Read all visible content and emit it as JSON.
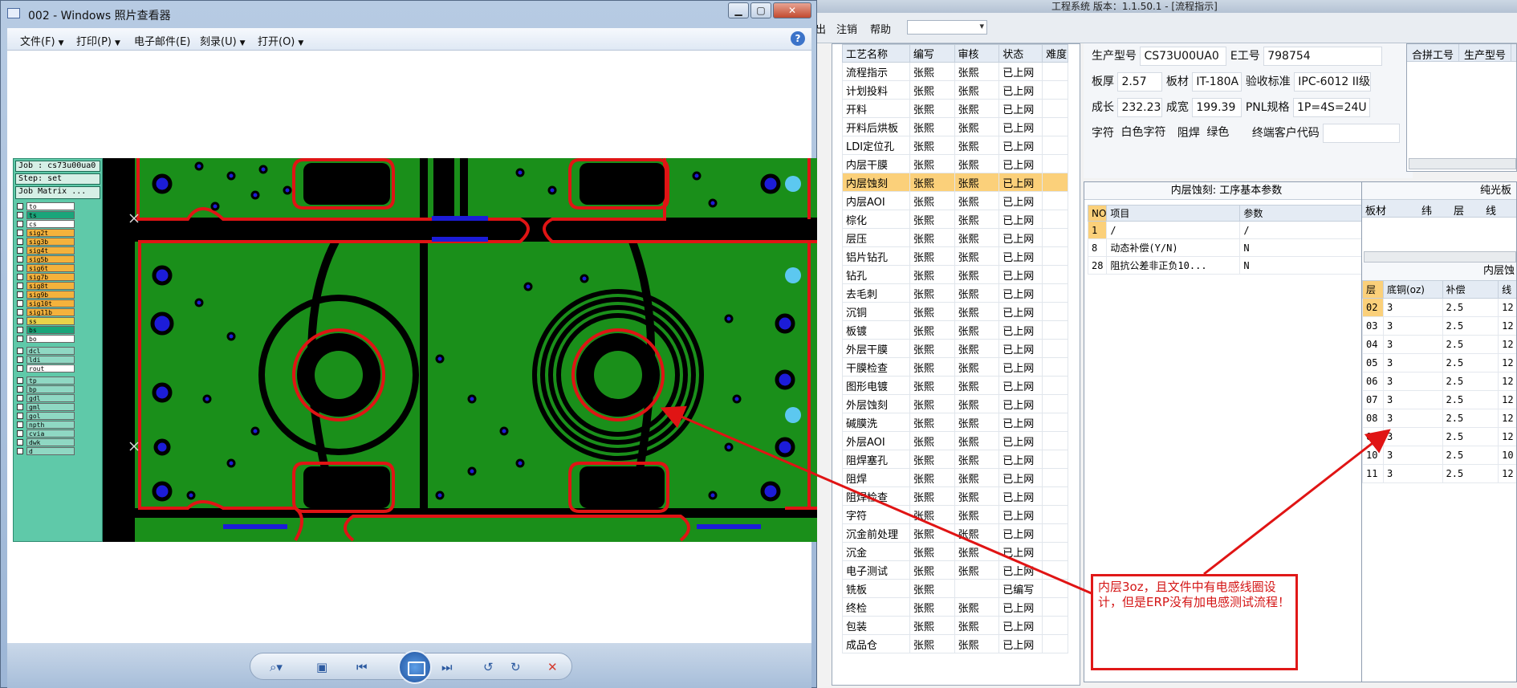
{
  "erp": {
    "title": "工程系统   版本：1.1.50.1 - [流程指示]",
    "menu": [
      "出",
      "注销",
      "帮助"
    ],
    "process_table": {
      "headers": [
        "工艺名称",
        "编写",
        "审核",
        "状态",
        "难度"
      ],
      "rows": [
        [
          "流程指示",
          "张熙",
          "张熙",
          "已上网"
        ],
        [
          "计划投料",
          "张熙",
          "张熙",
          "已上网"
        ],
        [
          "开料",
          "张熙",
          "张熙",
          "已上网"
        ],
        [
          "开料后烘板",
          "张熙",
          "张熙",
          "已上网"
        ],
        [
          "LDI定位孔",
          "张熙",
          "张熙",
          "已上网"
        ],
        [
          "内层干膜",
          "张熙",
          "张熙",
          "已上网"
        ],
        [
          "内层蚀刻",
          "张熙",
          "张熙",
          "已上网"
        ],
        [
          "内层AOI",
          "张熙",
          "张熙",
          "已上网"
        ],
        [
          "棕化",
          "张熙",
          "张熙",
          "已上网"
        ],
        [
          "层压",
          "张熙",
          "张熙",
          "已上网"
        ],
        [
          "铝片钻孔",
          "张熙",
          "张熙",
          "已上网"
        ],
        [
          "钻孔",
          "张熙",
          "张熙",
          "已上网"
        ],
        [
          "去毛刺",
          "张熙",
          "张熙",
          "已上网"
        ],
        [
          "沉铜",
          "张熙",
          "张熙",
          "已上网"
        ],
        [
          "板镀",
          "张熙",
          "张熙",
          "已上网"
        ],
        [
          "外层干膜",
          "张熙",
          "张熙",
          "已上网"
        ],
        [
          "干膜检查",
          "张熙",
          "张熙",
          "已上网"
        ],
        [
          "图形电镀",
          "张熙",
          "张熙",
          "已上网"
        ],
        [
          "外层蚀刻",
          "张熙",
          "张熙",
          "已上网"
        ],
        [
          "碱膜洗",
          "张熙",
          "张熙",
          "已上网"
        ],
        [
          "外层AOI",
          "张熙",
          "张熙",
          "已上网"
        ],
        [
          "阻焊塞孔",
          "张熙",
          "张熙",
          "已上网"
        ],
        [
          "阻焊",
          "张熙",
          "张熙",
          "已上网"
        ],
        [
          "阻焊检查",
          "张熙",
          "张熙",
          "已上网"
        ],
        [
          "字符",
          "张熙",
          "张熙",
          "已上网"
        ],
        [
          "沉金前处理",
          "张熙",
          "张熙",
          "已上网"
        ],
        [
          "沉金",
          "张熙",
          "张熙",
          "已上网"
        ],
        [
          "电子测试",
          "张熙",
          "张熙",
          "已上网"
        ],
        [
          "铣板",
          "张熙",
          "",
          "已编写"
        ],
        [
          "终检",
          "张熙",
          "张熙",
          "已上网"
        ],
        [
          "包装",
          "张熙",
          "张熙",
          "已上网"
        ],
        [
          "成品仓",
          "张熙",
          "张熙",
          "已上网"
        ]
      ],
      "selected_index": 6
    },
    "info": {
      "prod_model_label": "生产型号",
      "prod_model": "CS73U00UA0",
      "e_no_label": "E工号",
      "e_no": "798754",
      "thickness_label": "板厚",
      "thickness": "2.57",
      "material_label": "板材",
      "material": "IT-180A",
      "standard_label": "验收标准",
      "standard": "IPC-6012 II级",
      "length_label": "成长",
      "length": "232.23",
      "width_label": "成宽",
      "width": "199.39",
      "pnl_label": "PNL规格",
      "pnl": "1P=4S=24U",
      "char_label": "字符",
      "char": "白色字符",
      "mask_label": "阻焊",
      "mask": "绿色",
      "customer_code_label": "终端客户代码",
      "customer_code": ""
    },
    "merge_panel": {
      "headers": [
        "合拼工号",
        "生产型号"
      ]
    },
    "param_panel": {
      "title": "内层蚀刻: 工序基本参数",
      "headers": [
        "NO",
        "项目",
        "参数"
      ],
      "rows": [
        [
          "1",
          "/",
          "/"
        ],
        [
          "8",
          "动态补偿(Y/N)",
          "N"
        ],
        [
          "28",
          "阻抗公差非正负10...",
          "N"
        ]
      ]
    },
    "layer_panel": {
      "title1": "纯光板",
      "header2": [
        "板材",
        "纬",
        "层",
        "线"
      ],
      "title2": "内层蚀",
      "headers": [
        "层",
        "底铜(oz)",
        "补偿",
        "线"
      ],
      "rows": [
        [
          "02",
          "3",
          "2.5",
          "12"
        ],
        [
          "03",
          "3",
          "2.5",
          "12"
        ],
        [
          "04",
          "3",
          "2.5",
          "12"
        ],
        [
          "05",
          "3",
          "2.5",
          "12"
        ],
        [
          "06",
          "3",
          "2.5",
          "12"
        ],
        [
          "07",
          "3",
          "2.5",
          "12"
        ],
        [
          "08",
          "3",
          "2.5",
          "12"
        ],
        [
          "09",
          "3",
          "2.5",
          "12"
        ],
        [
          "10",
          "3",
          "2.5",
          "10"
        ],
        [
          "11",
          "3",
          "2.5",
          "12"
        ]
      ]
    }
  },
  "viewer": {
    "title": "002 - Windows 照片查看器",
    "menu": [
      "文件(F)",
      "打印(P)",
      "电子邮件(E)",
      "刻录(U)",
      "打开(O)"
    ],
    "cam": {
      "job": "Job : cs73u00ua0",
      "step": "Step: set",
      "matrix": "Job Matrix ...",
      "layers": [
        "to",
        "ts",
        "cs",
        "sig2t",
        "sig3b",
        "sig4t",
        "sig5b",
        "sig6t",
        "sig7b",
        "sig8t",
        "sig9b",
        "sig10t",
        "sig11b",
        "ss",
        "bs",
        "bo",
        "dcl",
        "ldi",
        "rout",
        "tp",
        "bp",
        "gdl",
        "gml",
        "gol",
        "npth",
        "cvia",
        "dwk",
        "d"
      ],
      "layer_colors": [
        "#ffffff",
        "#1aa57a",
        "#ffffff",
        "#f4b23c",
        "#f4b23c",
        "#f4b23c",
        "#f4b23c",
        "#f4b23c",
        "#f4b23c",
        "#f4b23c",
        "#f4b23c",
        "#f4b23c",
        "#f4b23c",
        "#e9d24a",
        "#1aa57a",
        "#ffffff",
        "#8fd8c3",
        "#8fd8c3",
        "#ffffff",
        "#8fd8c3",
        "#8fd8c3",
        "#8fd8c3",
        "#8fd8c3",
        "#8fd8c3",
        "#8fd8c3",
        "#8fd8c3",
        "#8fd8c3",
        "#8fd8c3"
      ]
    },
    "colors": {
      "copper_green": "#1a8f1a",
      "outline_red": "#e01414",
      "pad_blue": "#1c1cd8",
      "pad_cyan": "#5cc8f0"
    },
    "toolbar_icons": [
      "zoom-icon",
      "fit-icon",
      "previous-icon",
      "slideshow-icon",
      "next-icon",
      "rotate-left-icon",
      "rotate-right-icon",
      "delete-icon"
    ]
  },
  "callout": {
    "text": "内层3oz，且文件中有电感线圈设计，但是ERP没有加电感测试流程！"
  }
}
